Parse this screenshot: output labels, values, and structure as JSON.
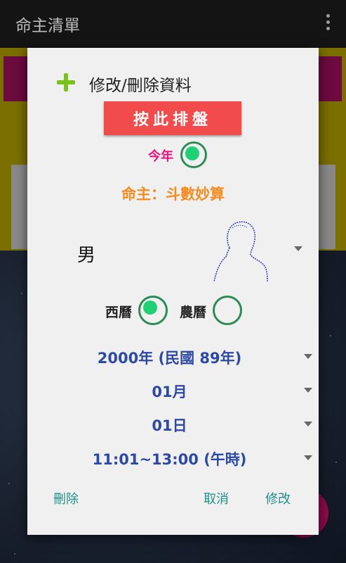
{
  "appbar": {
    "title": "命主清單",
    "menu_icon": "more-vert-icon"
  },
  "dialog": {
    "title": "修改/刪除資料",
    "chart_button": "按此排盤",
    "this_year_label": "今年",
    "this_year_selected": true,
    "owner_line": "命主：斗數妙算",
    "gender": "男",
    "calendar": {
      "western_label": "西曆",
      "western_selected": true,
      "lunar_label": "農曆",
      "lunar_selected": false
    },
    "year": "2000年 (民國 89年)",
    "month": "01月",
    "day": "01日",
    "time": "11:01~13:00 (午時)",
    "actions": {
      "delete": "刪除",
      "cancel": "取消",
      "modify": "修改"
    }
  },
  "colors": {
    "accent_red": "#f24b4b",
    "radio_green": "#1fd174",
    "owner_orange": "#f68a1e",
    "date_blue": "#2c4aa3",
    "action_teal": "#1f8f8a",
    "this_year_pink": "#e8137e"
  }
}
